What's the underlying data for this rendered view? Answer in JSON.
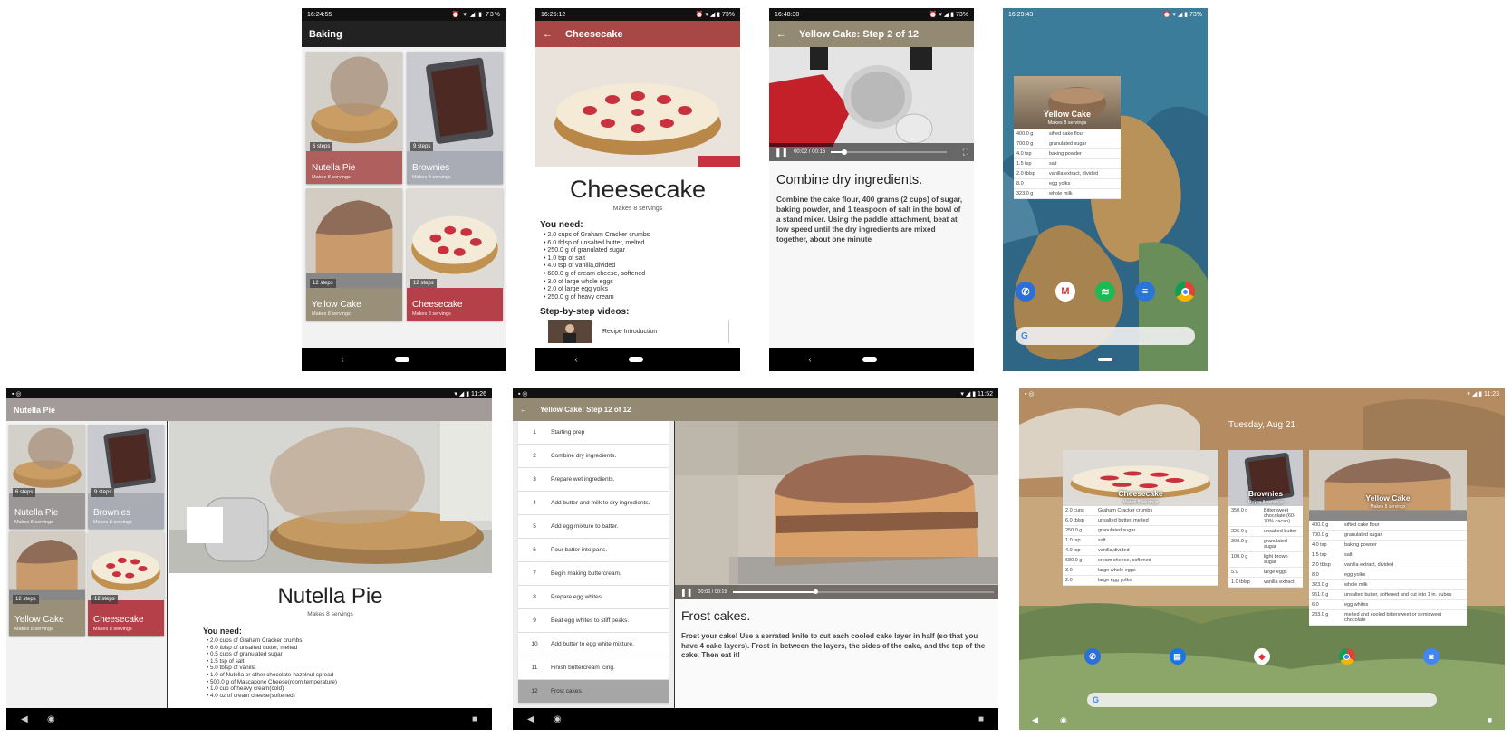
{
  "screen1": {
    "status_time": "16:24:55",
    "battery": "73%",
    "title": "Baking",
    "cards": [
      {
        "name": "Nutella Pie",
        "servings": "Makes 8 servings",
        "steps": "6 steps",
        "color": "#b05f5f"
      },
      {
        "name": "Brownies",
        "servings": "Makes 8 servings",
        "steps": "9 steps",
        "color": "#a9acb5"
      },
      {
        "name": "Yellow Cake",
        "servings": "Makes 8 servings",
        "steps": "12 steps",
        "color": "#9a9079"
      },
      {
        "name": "Cheesecake",
        "servings": "Makes 8 servings",
        "steps": "12 steps",
        "color": "#b5404a"
      }
    ]
  },
  "screen2": {
    "status_time": "16:25:12",
    "battery": "73%",
    "title": "Cheesecake",
    "heading": "Cheesecake",
    "servings": "Makes 8 servings",
    "you_need": "You need:",
    "ingredients": [
      "2.0 cups of Graham Cracker crumbs",
      "6.0 tblsp of unsalted butter, melted",
      "250.0 g of granulated sugar",
      "1.0 tsp of salt",
      "4.0 tsp of vanilla,divided",
      "680.0 g of cream cheese, softened",
      "3.0 of large whole eggs",
      "2.0 of large egg yolks",
      "250.0 g of heavy cream"
    ],
    "videos_heading": "Step-by-step videos:",
    "video_item": "Recipe Introduction"
  },
  "screen3": {
    "status_time": "16:48:30",
    "battery": "73%",
    "title": "Yellow Cake: Step 2 of 12",
    "time": "00:02 / 00:16",
    "progress": 0.12,
    "step_title": "Combine dry ingredients.",
    "step_text": "Combine the cake flour, 400 grams (2 cups) of sugar, baking powder, and 1 teaspoon of salt in the bowl of a stand mixer. Using the paddle attachment, beat at low speed until the dry ingredients are mixed together, about one minute"
  },
  "screen4": {
    "status_time": "16:29:43",
    "battery": "73%",
    "widget_title": "Yellow Cake",
    "widget_servings": "Makes 8 servings",
    "rows": [
      [
        "400.0 g",
        "sifted cake flour"
      ],
      [
        "700.0 g",
        "granulated sugar"
      ],
      [
        "4.0 tsp",
        "baking powder"
      ],
      [
        "1.5 tsp",
        "salt"
      ],
      [
        "2.0 tblsp",
        "vanilla extract, divided"
      ],
      [
        "8.0",
        "egg yolks"
      ],
      [
        "323.0 g",
        "whole milk"
      ]
    ],
    "search_g": "G"
  },
  "tablet1": {
    "status_time": "11:26",
    "title": "Nutella Pie",
    "cards": [
      {
        "name": "Nutella Pie",
        "servings": "Makes 8 servings",
        "steps": "6 steps",
        "color": "#9c9797"
      },
      {
        "name": "Brownies",
        "servings": "Makes 8 servings",
        "steps": "9 steps",
        "color": "#a9acb5"
      },
      {
        "name": "Yellow Cake",
        "servings": "Makes 8 servings",
        "steps": "12 steps",
        "color": "#9a9079"
      },
      {
        "name": "Cheesecake",
        "servings": "Makes 8 servings",
        "steps": "12 steps",
        "color": "#b5404a"
      }
    ],
    "heading": "Nutella Pie",
    "servings": "Makes 8 servings",
    "you_need": "You need:",
    "ingredients": [
      "2.0 cups of Graham Cracker crumbs",
      "6.0 tblsp of unsalted butter, melted",
      "0.5 cups of granulated sugar",
      "1.5 tsp of salt",
      "5.0 tblsp of vanilla",
      "1.0 of Nutella or other chocolate-hazelnut spread",
      "500.0 g of Mascapone Cheese(room temperature)",
      "1.0 cup of heavy cream(cold)",
      "4.0 oz of cream cheese(softened)"
    ]
  },
  "tablet2": {
    "status_time": "11:52",
    "title": "Yellow Cake: Step 12 of 12",
    "steps": [
      {
        "n": "1",
        "label": "Starting prep"
      },
      {
        "n": "2",
        "label": "Combine dry ingredients."
      },
      {
        "n": "3",
        "label": "Prepare wet ingredients."
      },
      {
        "n": "4",
        "label": "Add butter and milk to dry ingredients."
      },
      {
        "n": "5",
        "label": "Add egg mixture to batter."
      },
      {
        "n": "6",
        "label": "Pour batter into pans."
      },
      {
        "n": "7",
        "label": "Begin making buttercream."
      },
      {
        "n": "8",
        "label": "Prepare egg whites."
      },
      {
        "n": "9",
        "label": "Beat egg whites to stiff peaks."
      },
      {
        "n": "10",
        "label": "Add butter to egg white mixture."
      },
      {
        "n": "11",
        "label": "Finish buttercream icing."
      },
      {
        "n": "12",
        "label": "Frost cakes."
      }
    ],
    "selected_step": 12,
    "time": "00:06 / 00:19",
    "progress": 0.32,
    "step_title": "Frost cakes.",
    "step_text": "Frost your cake! Use a serrated knife to cut each cooled cake layer in half (so that you have 4 cake layers). Frost in between the layers, the sides of the cake, and the top of the cake. Then eat it!"
  },
  "tablet3": {
    "status_time": "11:23",
    "date": "Tuesday, Aug 21",
    "widgets": [
      {
        "title": "Cheesecake",
        "servings": "Makes 8 servings",
        "rows": [
          [
            "2.0 cups",
            "Graham Cracker crumbs"
          ],
          [
            "6.0 tblsp",
            "unsalted butter, melted"
          ],
          [
            "250.0 g",
            "granulated sugar"
          ],
          [
            "1.0 tsp",
            "salt"
          ],
          [
            "4.0 tsp",
            "vanilla,divided"
          ],
          [
            "680.0 g",
            "cream cheese, softened"
          ],
          [
            "3.0",
            "large whole eggs"
          ],
          [
            "2.0",
            "large egg yolks"
          ]
        ]
      },
      {
        "title": "Brownies",
        "servings": "Makes 8 servings",
        "rows": [
          [
            "350.0 g",
            "Bittersweet chocolate (60-70% cacao)"
          ],
          [
            "226.0 g",
            "unsalted butter"
          ],
          [
            "300.0 g",
            "granulated sugar"
          ],
          [
            "100.0 g",
            "light brown sugar"
          ],
          [
            "5.0",
            "large eggs"
          ],
          [
            "1.0 tblsp",
            "vanilla extract"
          ]
        ]
      },
      {
        "title": "Yellow Cake",
        "servings": "Makes 8 servings",
        "rows": [
          [
            "400.0 g",
            "sifted cake flour"
          ],
          [
            "700.0 g",
            "granulated sugar"
          ],
          [
            "4.0 tsp",
            "baking powder"
          ],
          [
            "1.5 tsp",
            "salt"
          ],
          [
            "2.0 tblsp",
            "vanilla extract, divided"
          ],
          [
            "8.0",
            "egg yolks"
          ],
          [
            "323.0 g",
            "whole milk"
          ],
          [
            "961.0 g",
            "unsalted butter, softened and cut into 1 in. cubes"
          ],
          [
            "6.0",
            "egg whites"
          ],
          [
            "283.0 g",
            "melted and cooled bittersweet or semisweet chocolate"
          ]
        ]
      }
    ],
    "search_g": "G"
  }
}
